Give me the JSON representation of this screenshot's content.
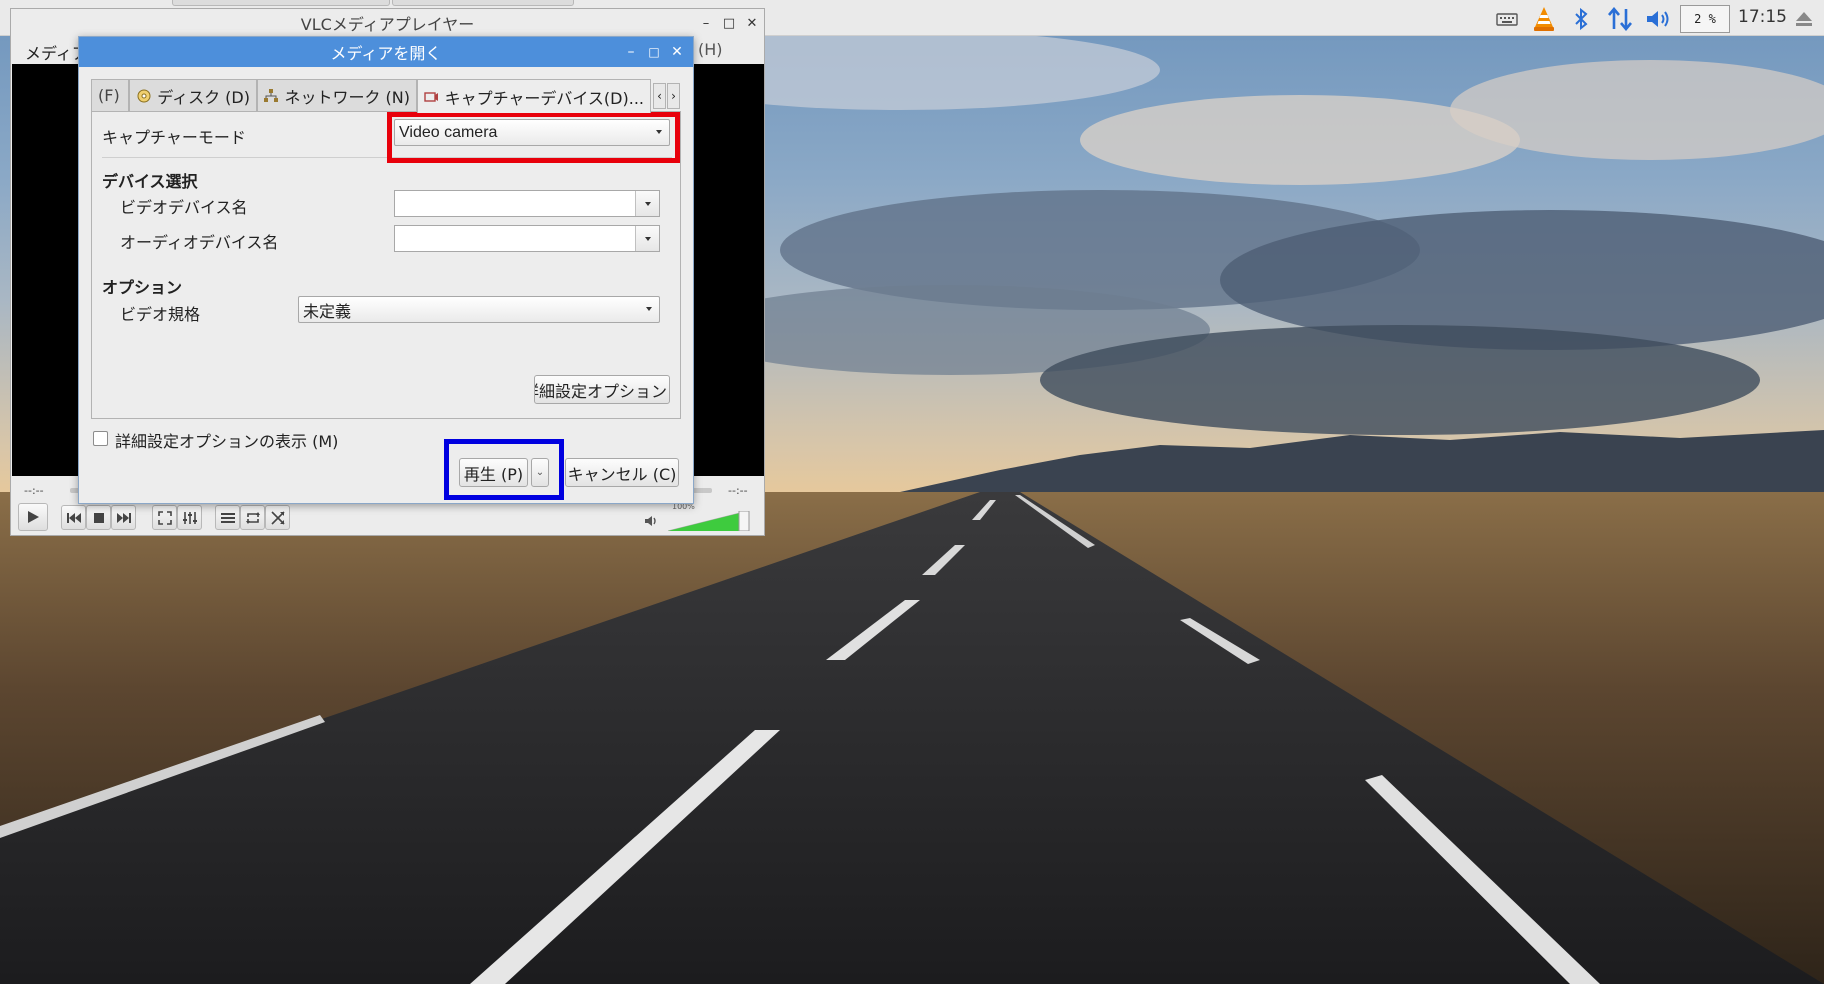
{
  "desktop": {
    "panel": {
      "cpu_usage": "2 %",
      "clock": "17:15"
    }
  },
  "vlc": {
    "title": "VLCメディアプレイヤー",
    "menu": {
      "media_label": "メディア",
      "help_label": "(H)"
    },
    "time": {
      "elapsed": "--:--",
      "remaining": "--:--"
    },
    "volume": {
      "level_text": "100%",
      "level": 1.0
    }
  },
  "dialog": {
    "title": "メディアを開く",
    "tabs": [
      {
        "label": "(F)",
        "icon": "file-icon"
      },
      {
        "label": "ディスク (D)",
        "icon": "disc-icon"
      },
      {
        "label": "ネットワーク (N)",
        "icon": "network-icon"
      },
      {
        "label": "キャプチャーデバイス(D)...",
        "icon": "capture-device-icon",
        "active": true
      }
    ],
    "capture_mode": {
      "label": "キャプチャーモード",
      "value": "Video camera"
    },
    "device_selection": {
      "heading": "デバイス選択",
      "video_device_label": "ビデオデバイス名",
      "video_device_value": "",
      "audio_device_label": "オーディオデバイス名",
      "audio_device_value": ""
    },
    "options": {
      "heading": "オプション",
      "video_standard_label": "ビデオ規格",
      "video_standard_value": "未定義",
      "advanced_button": "詳細設定オプション"
    },
    "show_advanced": {
      "label": "詳細設定オプションの表示 (M)",
      "checked": false
    },
    "play_button": "再生 (P)",
    "cancel_button": "キャンセル (C)"
  },
  "highlights": {
    "red": "#e8000b",
    "blue": "#0000e0"
  }
}
